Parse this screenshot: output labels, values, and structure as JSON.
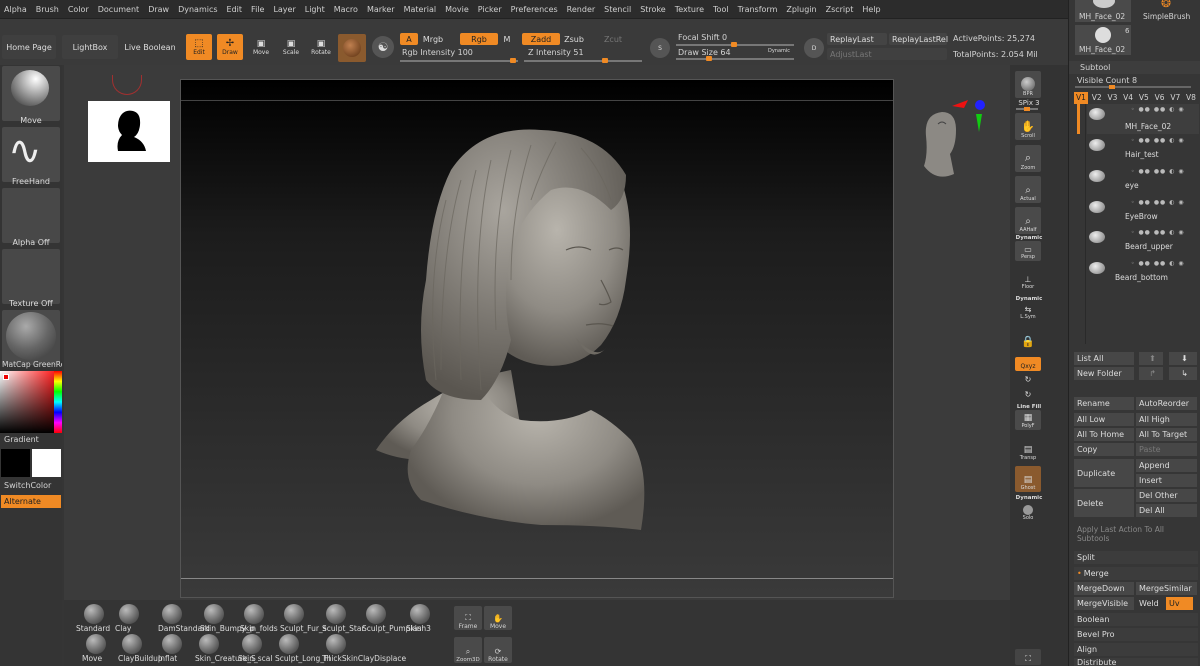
{
  "menu": [
    "Alpha",
    "Brush",
    "Color",
    "Document",
    "Draw",
    "Dynamics",
    "Edit",
    "File",
    "Layer",
    "Light",
    "Macro",
    "Marker",
    "Material",
    "Movie",
    "Picker",
    "Preferences",
    "Render",
    "Stencil",
    "Stroke",
    "Texture",
    "Tool",
    "Transform",
    "Zplugin",
    "Zscript",
    "Help"
  ],
  "top": {
    "home": "Home Page",
    "lightbox": "LightBox",
    "liveboolean": "Live Boolean",
    "edit": "Edit",
    "draw": "Draw",
    "move": "Move",
    "scale": "Scale",
    "rotate": "Rotate",
    "a": "A",
    "mrgb": "Mrgb",
    "rgb": "Rgb",
    "m": "M",
    "zadd": "Zadd",
    "zsub": "Zsub",
    "zcut": "Zcut",
    "rgb_intensity": "Rgb Intensity 100",
    "z_intensity": "Z Intensity 51",
    "s_label": "S",
    "d_label": "D",
    "focal_shift": "Focal Shift 0",
    "draw_size": "Draw Size 64",
    "dynamic": "Dynamic",
    "replaylast": "ReplayLast",
    "replaylastrel": "ReplayLastRel",
    "adjustlast": "AdjustLast",
    "active_points": "ActivePoints: 25,274",
    "total_points": "TotalPoints: 2.054 Mil"
  },
  "left": {
    "move": "Move",
    "freehand": "FreeHand",
    "alpha_off": "Alpha Off",
    "texture_off": "Texture Off",
    "matcap": "MatCap GreenRe",
    "gradient": "Gradient",
    "switchcolor": "SwitchColor",
    "alternate": "Alternate"
  },
  "right": {
    "bpr": "BPR",
    "spix": "SPix 3",
    "scroll": "Scroll",
    "zoom": "Zoom",
    "actual": "Actual",
    "aahalf": "AAHalf",
    "dynamic1": "Dynamic",
    "persp": "Persp",
    "floor": "Floor",
    "dynamic2": "Dynamic",
    "lsym": "L.Sym",
    "xyz": "Qxyz",
    "linefill": "Line Fill",
    "polyf": "PolyF",
    "transp": "Transp",
    "ghost": "Ghost",
    "dynamic3": "Dynamic",
    "solo": "Solo"
  },
  "tray": {
    "top_tool": "MH_Face_02",
    "simple_brush": "SimpleBrush",
    "tool2": "MH_Face_02",
    "tool2_count": "6",
    "subtool": "Subtool",
    "visible_count": "Visible Count 8",
    "versions": [
      "V1",
      "V2",
      "V3",
      "V4",
      "V5",
      "V6",
      "V7",
      "V8"
    ],
    "subtools": [
      "MH_Face_02",
      "Hair_test",
      "eye",
      "EyeBrow",
      "Beard_upper",
      "Beard_bottom"
    ],
    "listall": "List All",
    "newfolder": "New Folder",
    "rename": "Rename",
    "autoreorder": "AutoReorder",
    "alllow": "All Low",
    "allhigh": "All High",
    "alltohome": "All To Home",
    "alltotarget": "All To Target",
    "copy": "Copy",
    "paste": "Paste",
    "duplicate": "Duplicate",
    "append": "Append",
    "insert": "Insert",
    "delete": "Delete",
    "delother": "Del Other",
    "delall": "Del All",
    "applylast": "Apply Last Action To All Subtools",
    "split": "Split",
    "merge": "Merge",
    "mergedown": "MergeDown",
    "mergesimilar": "MergeSimilar",
    "mergevisible": "MergeVisible",
    "weld": "Weld",
    "uv": "Uv",
    "boolean": "Boolean",
    "bevelpro": "Bevel Pro",
    "align": "Align",
    "distribute": "Distribute"
  },
  "brushes_row1": [
    "Standard",
    "Clay",
    "DamStandard",
    "Skin_Bumpy_p",
    "Skin_folds",
    "Sculpt_Fur_s",
    "Sculpt_Star",
    "Sculpt_Pumpkin",
    "Slash3"
  ],
  "brushes_row1_labels": [
    "Standard",
    "Clay",
    "DamStandard",
    "Skin_Bumpy_p",
    "Skin_folds",
    "Sculpt_Fur_s",
    "Sculpt_Star",
    "Sculpt_Pumpkin",
    "Slash3"
  ],
  "brushes_row2": [
    "Move",
    "ClayBuildup",
    "Inflat",
    "Skin_Creature_S",
    "Skin_scal",
    "Sculpt_Long_Fl",
    "ThickSkinClayDisplace"
  ],
  "nav": {
    "frame": "Frame",
    "move": "Move",
    "zoom3d": "Zoom3D",
    "rotate": "Rotate"
  },
  "colors": {
    "accent": "#f08a24"
  }
}
